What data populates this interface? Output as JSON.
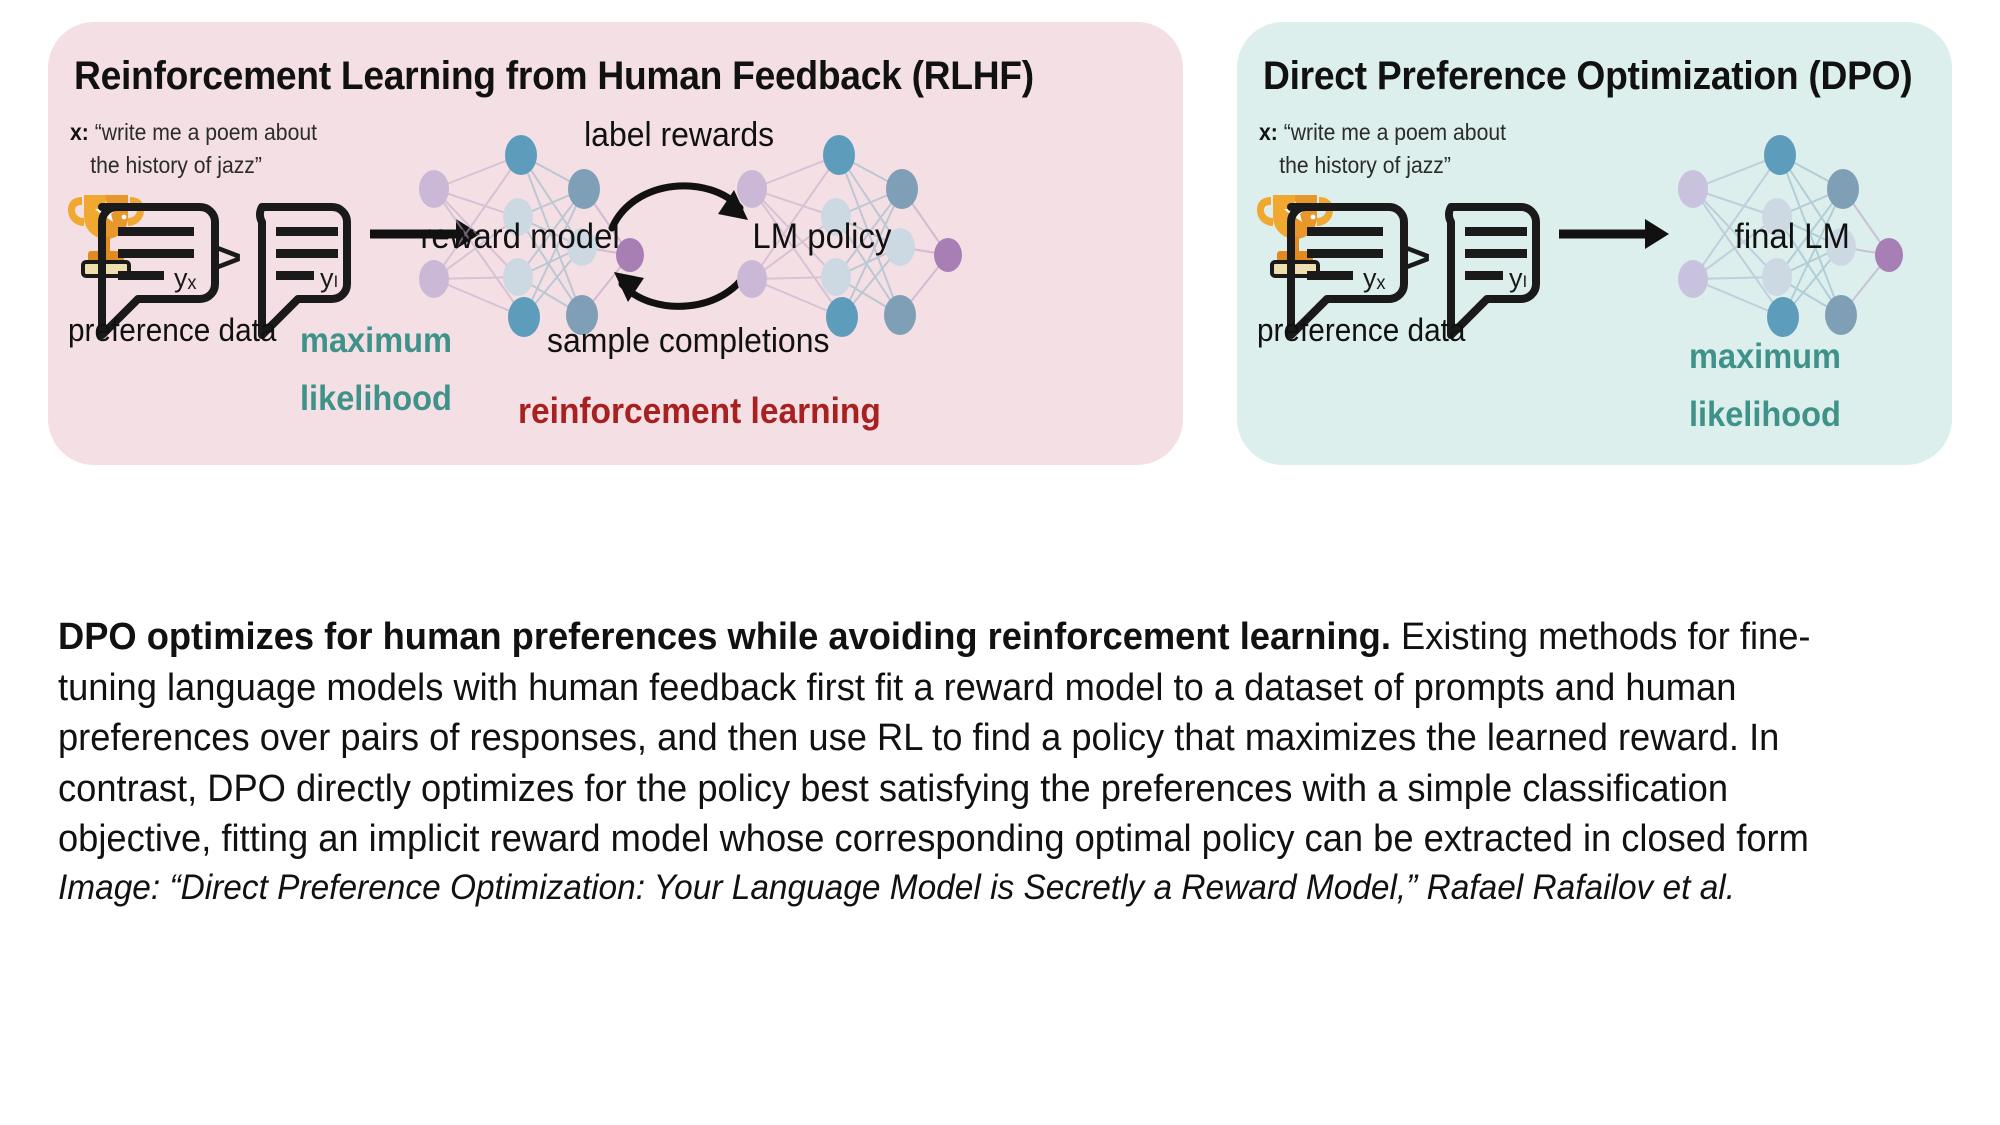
{
  "figure": {
    "panels": [
      {
        "id": "rlhf",
        "title": "Reinforcement Learning from Human Feedback (RLHF)",
        "bg_color": "#f4e0e4",
        "prompt_prefix": "x:",
        "prompt_line1": "“write me a poem about",
        "prompt_line2": "the history of jazz”",
        "preferred_label": "yₓ",
        "rejected_label": "yₗ",
        "comparison_symbol": ">",
        "data_caption": "preference data",
        "ml_line1": "maximum",
        "ml_line2": "likelihood",
        "ml_color": "#3e9289",
        "rl_label": "reinforcement learning",
        "rl_color": "#a82020",
        "network_left_label": "reward model",
        "network_right_label": "LM policy",
        "cycle_top_label": "label rewards",
        "cycle_bottom_label": "sample completions"
      },
      {
        "id": "dpo",
        "title": "Direct Preference Optimization (DPO)",
        "bg_color": "#dcefec",
        "prompt_prefix": "x:",
        "prompt_line1": "“write me a poem about",
        "prompt_line2": "the history of jazz”",
        "preferred_label": "yₓ",
        "rejected_label": "yₗ",
        "comparison_symbol": ">",
        "data_caption": "preference data",
        "ml_line1": "maximum",
        "ml_line2": "likelihood",
        "ml_color": "#3e9289",
        "network_label": "final LM"
      }
    ],
    "icons": {
      "trophy": "trophy-icon",
      "arrow": "right-arrow-icon",
      "cycle_top": "curved-arrow-right-icon",
      "cycle_bottom": "curved-arrow-left-icon"
    },
    "node_colors": {
      "input": "#cbb8d6",
      "input_pale": "#c9c2de",
      "hidden_dark": "#5e9cbb",
      "hidden_mid": "#7e9fb5",
      "hidden_pale": "#cdd9e2",
      "output": "#a87fb5"
    }
  },
  "caption": {
    "bold_lead": "DPO optimizes for human preferences while avoiding reinforcement learning.",
    "body": " Existing methods for fine-tuning language models with human feedback first fit a reward model to a dataset of prompts and human preferences over pairs of responses, and then use RL to find a policy that maximizes the learned reward. In contrast, DPO directly optimizes for the policy best satisfying the preferences with a simple classification objective, fitting an implicit reward model whose corresponding optimal policy can be extracted in closed form",
    "credit": "Image: “Direct Preference Optimization: Your Language Model is Secretly a Reward Model,” Rafael Rafailov et al."
  }
}
